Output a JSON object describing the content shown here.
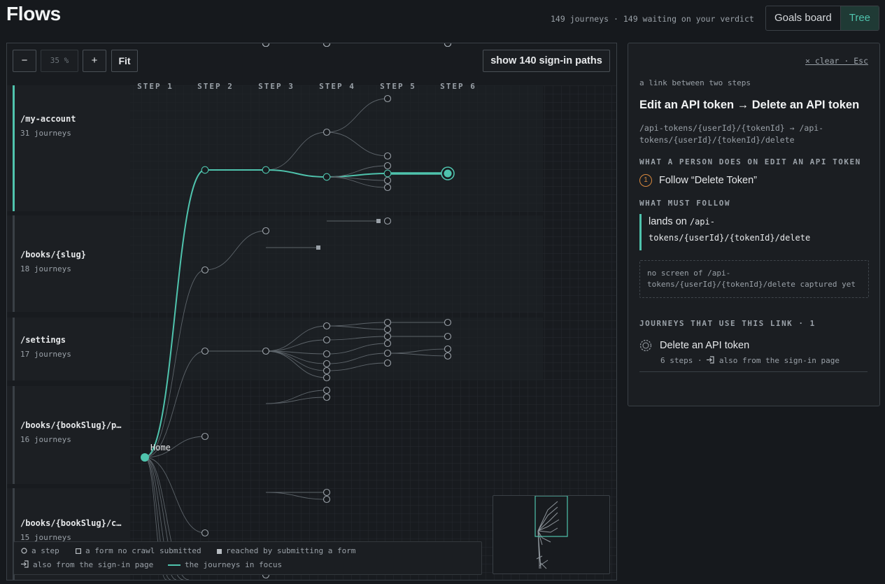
{
  "header": {
    "title": "Flows",
    "summary": "149 journeys · 149 waiting on your verdict",
    "views": [
      "Goals board",
      "Tree"
    ],
    "active_view": "Tree"
  },
  "toolbar": {
    "zoom_out": "−",
    "zoom_level": "35 %",
    "zoom_in": "+",
    "fit": "Fit",
    "signin_paths": "show 140 sign-in paths"
  },
  "tree": {
    "steps": [
      "STEP 1",
      "STEP 2",
      "STEP 3",
      "STEP 4",
      "STEP 5",
      "STEP 6"
    ],
    "root_label": "Home",
    "groups": [
      {
        "route": "/my-account",
        "count": "31 journeys"
      },
      {
        "route": "/books/{slug}",
        "count": "18 journeys"
      },
      {
        "route": "/settings",
        "count": "17 journeys"
      },
      {
        "route": "/books/{bookSlug}/p…",
        "count": "16 journeys"
      },
      {
        "route": "/books/{bookSlug}/c…",
        "count": "15 journeys"
      }
    ]
  },
  "legend": {
    "step": "a step",
    "form": "a form no crawl submitted",
    "reached": "reached by submitting a form",
    "signin": "also from the sign-in page",
    "focus": "the journeys in focus"
  },
  "colors": {
    "accent": "#4fc3ad",
    "warn": "#d9893e",
    "bg": "#16191d"
  },
  "panel": {
    "clear": "× clear · Esc",
    "kind": "a link between two steps",
    "title": "Edit an API token → Delete an API token",
    "path": "/api-tokens/{userId}/{tokenId} → /api-tokens/{userId}/{tokenId}/delete",
    "action_heading": "WHAT A PERSON DOES ON EDIT AN API TOKEN",
    "action_num": "1",
    "action": "Follow “Delete Token”",
    "follow_heading": "WHAT MUST FOLLOW",
    "follow_prefix": "lands on",
    "follow_path": "/api-tokens/{userId}/{tokenId}/delete",
    "no_screen": "no screen of /api-tokens/{userId}/{tokenId}/delete captured yet",
    "journeys_heading": "JOURNEYS THAT USE THIS LINK · 1",
    "journey_name": "Delete an API token",
    "journey_steps": "6 steps",
    "journey_signin": "also from the sign-in page"
  }
}
